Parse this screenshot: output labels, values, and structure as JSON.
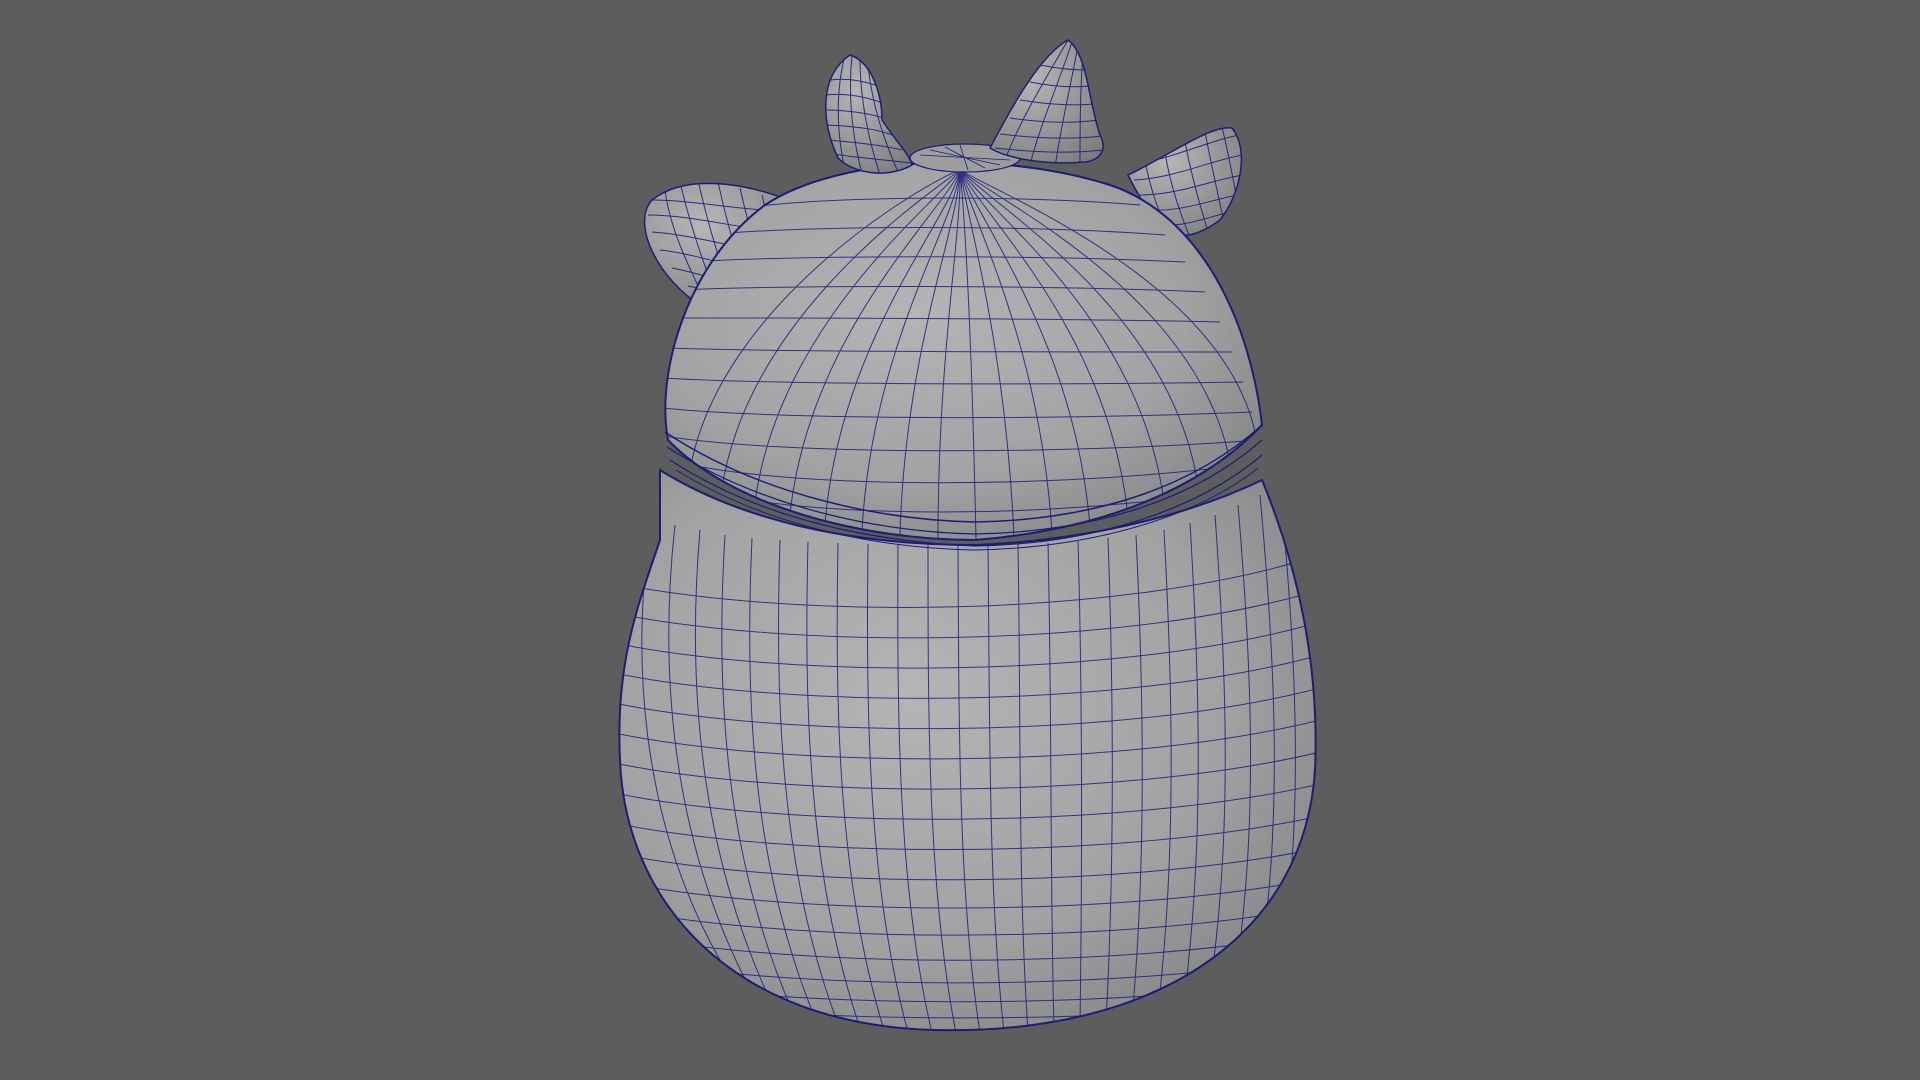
{
  "viewport": {
    "background_color": "#5d5d5d",
    "render_mode": "wireframe-on-shaded"
  },
  "model": {
    "parts": [
      "body",
      "lid",
      "lid-seam",
      "horn-left",
      "horn-right",
      "ear-left",
      "ear-right"
    ],
    "surface_color": "#a5a5a5",
    "wire_color": "#1d1d78"
  }
}
